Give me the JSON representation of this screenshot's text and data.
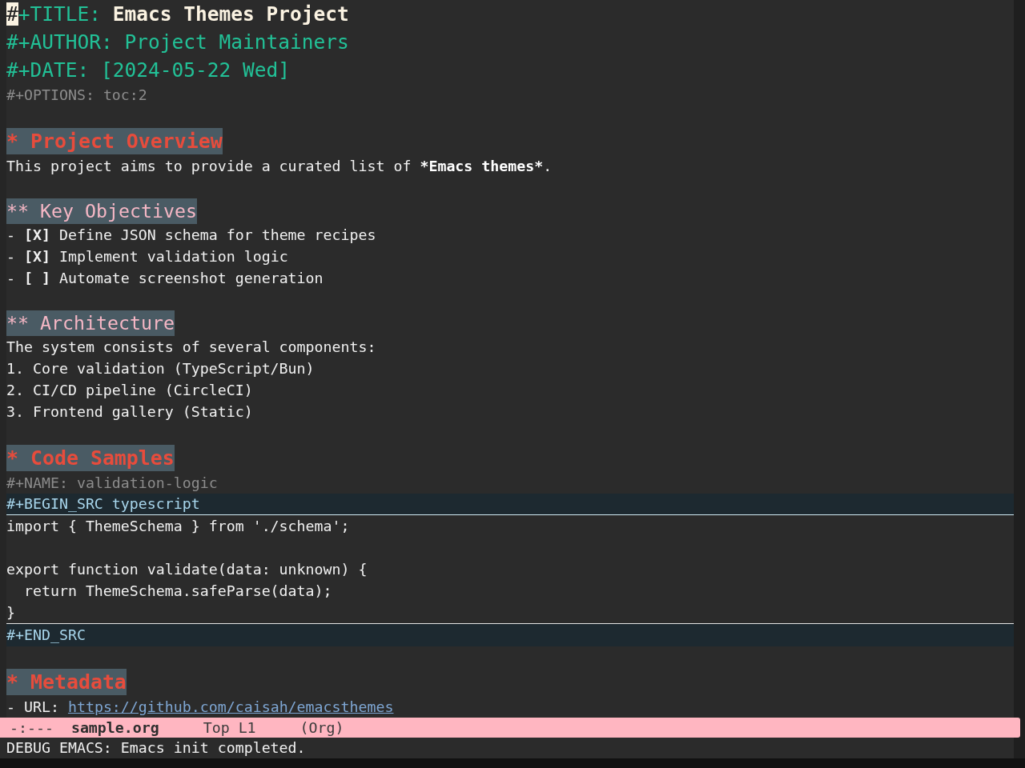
{
  "buffer": {
    "preamble": [
      {
        "kind": "title",
        "key": "#+TITLE:",
        "value": "Emacs Themes Project",
        "cursor": true
      },
      {
        "kind": "meta",
        "key": "#+AUTHOR:",
        "value": "Project Maintainers",
        "cursor": false
      },
      {
        "kind": "meta",
        "key": "#+DATE:",
        "value": "[2024-05-22 Wed]",
        "cursor": false
      },
      {
        "kind": "setting",
        "key": "#+OPTIONS:",
        "value": "toc:2",
        "cursor": false
      },
      {
        "kind": "blank"
      }
    ],
    "sections": [
      {
        "heading": "* Project Overview",
        "body": [
          {
            "kind": "paragraph",
            "parts": [
              {
                "text": "This project aims to provide a curated list of ",
                "bold": false
              },
              {
                "text": "*Emacs themes*",
                "bold": true
              },
              {
                "text": ".",
                "bold": false
              }
            ]
          },
          {
            "kind": "blank"
          }
        ],
        "children": [
          {
            "heading": "** Key Objectives",
            "body": [
              {
                "kind": "checkitem",
                "bullet": "-",
                "box": "[X]",
                "text": "Define JSON schema for theme recipes"
              },
              {
                "kind": "checkitem",
                "bullet": "-",
                "box": "[X]",
                "text": "Implement validation logic"
              },
              {
                "kind": "checkitem",
                "bullet": "-",
                "box": "[ ]",
                "text": "Automate screenshot generation"
              },
              {
                "kind": "blank"
              }
            ]
          },
          {
            "heading": "** Architecture",
            "body": [
              {
                "kind": "text",
                "text": "The system consists of several components:"
              },
              {
                "kind": "text",
                "text": "1. Core validation (TypeScript/Bun)"
              },
              {
                "kind": "text",
                "text": "2. CI/CD pipeline (CircleCI)"
              },
              {
                "kind": "text",
                "text": "3. Frontend gallery (Static)"
              },
              {
                "kind": "blank"
              }
            ]
          }
        ]
      },
      {
        "heading": "* Code Samples",
        "body": [
          {
            "kind": "setting",
            "key": "#+NAME:",
            "value": "validation-logic",
            "cursor": false
          },
          {
            "kind": "src",
            "begin": "#+BEGIN_SRC typescript",
            "code": "import { ThemeSchema } from './schema';\n\nexport function validate(data: unknown) {\n  return ThemeSchema.safeParse(data);\n}",
            "end": "#+END_SRC"
          },
          {
            "kind": "blank"
          }
        ]
      },
      {
        "heading": "* Metadata",
        "body": [
          {
            "kind": "link",
            "label": "- URL:",
            "url": "https://github.com/caisah/emacsthemes"
          }
        ]
      }
    ]
  },
  "mode_line": {
    "state": "-:---",
    "buffer_name": "sample.org",
    "position": "Top L1",
    "mode": "(Org)"
  },
  "echo_area": "DEBUG EMACS: Emacs init completed."
}
